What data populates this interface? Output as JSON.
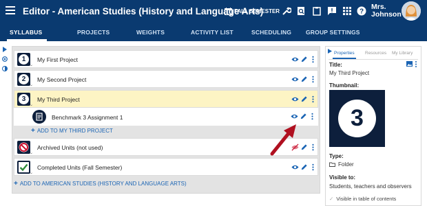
{
  "header": {
    "title": "Editor - American Studies (History and Language Arts)",
    "semester": "FALL SEMESTER",
    "user_first": "Mrs.",
    "user_last": "Johnson"
  },
  "tabs": [
    {
      "label": "SYLLABUS",
      "active": true
    },
    {
      "label": "PROJECTS"
    },
    {
      "label": "WEIGHTS"
    },
    {
      "label": "ACTIVITY LIST"
    },
    {
      "label": "SCHEDULING"
    },
    {
      "label": "GROUP SETTINGS"
    }
  ],
  "units": [
    {
      "number": "1",
      "label": "My First Project"
    },
    {
      "number": "2",
      "label": "My Second Project"
    },
    {
      "number": "3",
      "label": "My Third Project",
      "highlighted": true
    },
    {
      "label": "Archived Units (not used)"
    },
    {
      "label": "Completed Units (Fall Semester)"
    }
  ],
  "child": {
    "label": "Benchmark 3 Assignment 1",
    "add_label": "ADD TO MY THIRD PROJECT"
  },
  "add_course_label": "ADD TO AMERICAN STUDIES (HISTORY AND LANGUAGE ARTS)",
  "side": {
    "tabs": [
      "Properties",
      "Resources",
      "My Library"
    ],
    "title_label": "Title:",
    "title_value": "My Third Project",
    "thumbnail_label": "Thumbnail:",
    "thumbnail_number": "3",
    "type_label": "Type:",
    "type_value": "Folder",
    "visible_label": "Visible to:",
    "visible_value": "Students, teachers and observers",
    "toc_label": "Visible in table of contents"
  },
  "colors": {
    "header_bg": "#0a3a70",
    "accent": "#1a64b4",
    "highlight_row": "#fdf4c4",
    "archived_red": "#c8102e",
    "completed_green": "#2e8b3a",
    "arrow_red": "#b01020"
  }
}
